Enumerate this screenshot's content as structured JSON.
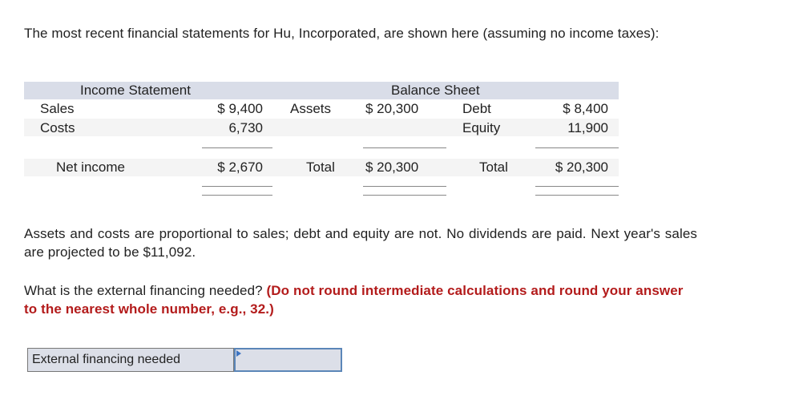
{
  "intro": "The most recent financial statements for Hu, Incorporated, are shown here (assuming no income taxes):",
  "income_statement": {
    "title": "Income Statement",
    "rows": [
      {
        "label": "Sales",
        "value": "$ 9,400"
      },
      {
        "label": "Costs",
        "value": "6,730"
      }
    ],
    "total": {
      "label": "Net income",
      "value": "$ 2,670"
    }
  },
  "balance_sheet": {
    "title": "Balance Sheet",
    "assets": {
      "label": "Assets",
      "value": "$ 20,300",
      "total_label": "Total",
      "total_value": "$ 20,300"
    },
    "liabilities": [
      {
        "label": "Debt",
        "value": "$ 8,400"
      },
      {
        "label": "Equity",
        "value": "11,900"
      }
    ],
    "liabilities_total": {
      "label": "Total",
      "value": "$ 20,300"
    }
  },
  "assumptions": "Assets and costs are proportional to sales; debt and equity are not. No dividends are paid. Next year's sales are projected to be $11,092.",
  "question": {
    "text": "What is the external financing needed? ",
    "instruction": "(Do not round intermediate calculations and round your answer to the nearest whole number, e.g., 32.)"
  },
  "answer": {
    "label": "External financing needed",
    "value": ""
  },
  "colors": {
    "header_bg": "#d9dde8",
    "instruction_red": "#b31b1b",
    "input_border": "#5b86b8"
  }
}
